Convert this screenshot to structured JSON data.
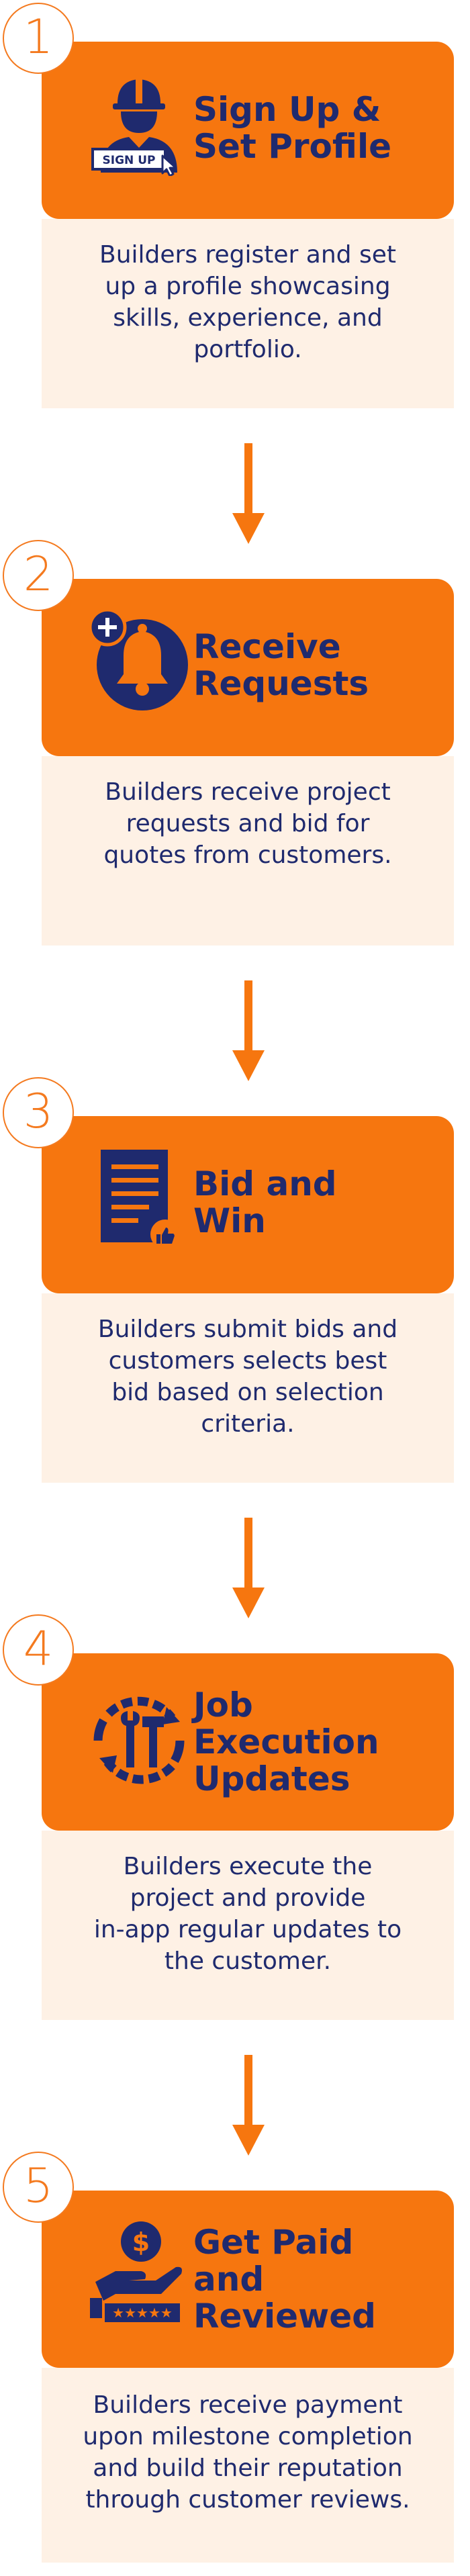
{
  "steps": [
    {
      "number": "1",
      "title_lines": [
        "Sign Up &",
        "Set Profile"
      ],
      "icon": "construction-worker-signup-icon",
      "icon_badge_text": "SIGN UP",
      "description_lines": [
        "Builders register and set",
        "up a profile showcasing",
        "skills, experience, and",
        "portfolio."
      ]
    },
    {
      "number": "2",
      "title_lines": [
        "Receive",
        "Requests"
      ],
      "icon": "notification-bell-plus-icon",
      "description_lines": [
        "Builders receive project",
        "requests and bid for",
        "quotes from customers."
      ]
    },
    {
      "number": "3",
      "title_lines": [
        "Bid and",
        "Win"
      ],
      "icon": "document-thumbs-up-icon",
      "description_lines": [
        "Builders submit bids and",
        "customers selects best",
        "bid based on selection",
        "criteria."
      ]
    },
    {
      "number": "4",
      "title_lines": [
        "Job",
        "Execution",
        "Updates"
      ],
      "icon": "tools-cycle-icon",
      "description_lines": [
        "Builders execute the",
        "project and provide",
        "in-app regular updates to",
        "the customer."
      ]
    },
    {
      "number": "5",
      "title_lines": [
        "Get Paid",
        "and",
        "Reviewed"
      ],
      "icon": "hand-money-stars-icon",
      "description_lines": [
        "Builders receive payment",
        "upon milestone completion",
        "and build their reputation",
        "through customer reviews."
      ]
    }
  ],
  "colors": {
    "accent": "#f6760f",
    "navy": "#1f2a6e",
    "body_bg": "#fef1e5"
  }
}
